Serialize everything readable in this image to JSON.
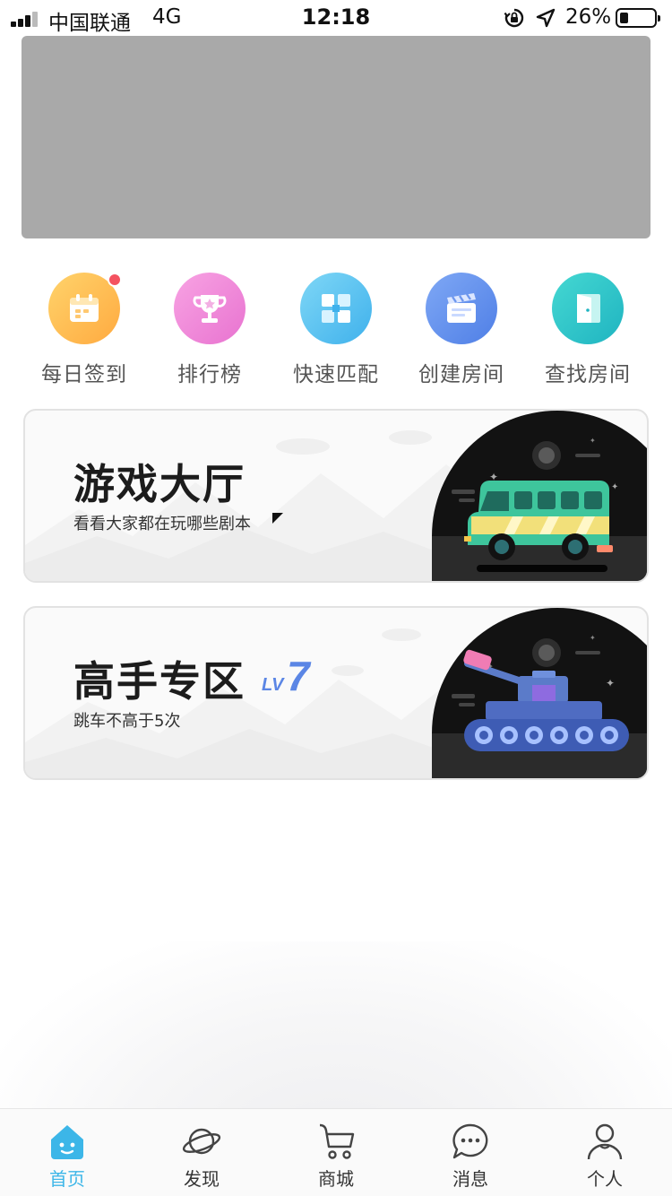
{
  "status_bar": {
    "carrier": "中国联通",
    "network": "4G",
    "time": "12:18",
    "battery": "26%",
    "battery_level": 0.26,
    "icons": [
      "signal-icon",
      "rotation-lock-icon",
      "location-icon",
      "battery-icon"
    ]
  },
  "banner": {
    "color": "#a9a9a9"
  },
  "quick_actions": [
    {
      "label": "每日签到",
      "icon": "calendar-icon",
      "color_from": "#ffd36b",
      "color_to": "#ffaa40",
      "badge": true
    },
    {
      "label": "排行榜",
      "icon": "trophy-icon",
      "color_from": "#f8a3e3",
      "color_to": "#e873d0",
      "badge": false
    },
    {
      "label": "快速匹配",
      "icon": "match-grid-icon",
      "color_from": "#7fd7f6",
      "color_to": "#3fb1ec",
      "badge": false
    },
    {
      "label": "创建房间",
      "icon": "clapperboard-icon",
      "color_from": "#7fa8f5",
      "color_to": "#4f7fe6",
      "badge": false
    },
    {
      "label": "查找房间",
      "icon": "door-icon",
      "color_from": "#45d8d2",
      "color_to": "#1fb4c1",
      "badge": false
    }
  ],
  "cards": {
    "lobby": {
      "title": "游戏大厅",
      "subtitle": "看看大家都在玩哪些剧本",
      "art": "bus-icon"
    },
    "expert": {
      "title": "高手专区",
      "subtitle": "跳车不高于5次",
      "level_prefix": "LV",
      "level_number": "7",
      "art": "tank-icon"
    }
  },
  "tabs": [
    {
      "label": "首页",
      "icon": "home-icon",
      "active": true
    },
    {
      "label": "发现",
      "icon": "planet-icon",
      "active": false
    },
    {
      "label": "商城",
      "icon": "cart-icon",
      "active": false
    },
    {
      "label": "消息",
      "icon": "chat-bubble-icon",
      "active": false
    },
    {
      "label": "个人",
      "icon": "person-icon",
      "active": false
    }
  ],
  "colors": {
    "accent": "#3cb6e8",
    "badge": "#f45260",
    "level": "#5b86e5"
  }
}
